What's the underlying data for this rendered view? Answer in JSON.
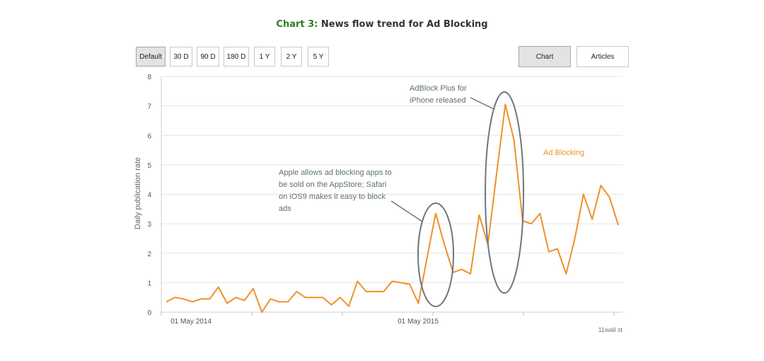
{
  "header": {
    "title_prefix": "Chart 3:",
    "title_text": "News flow trend for Ad Blocking"
  },
  "range_buttons": [
    {
      "label": "Default",
      "active": true
    },
    {
      "label": "30 D",
      "active": false
    },
    {
      "label": "90 D",
      "active": false
    },
    {
      "label": "180 D",
      "active": false
    },
    {
      "label": "1 Y",
      "active": false
    },
    {
      "label": "2 Y",
      "active": false
    },
    {
      "label": "5 Y",
      "active": false
    }
  ],
  "view_toggle": {
    "chart_label": "Chart",
    "articles_label": "Articles",
    "active": "Chart"
  },
  "colors": {
    "series": "#f0902a",
    "annotation": "#5e6f78",
    "title_prefix": "#2e7d1e",
    "grid": "#e4e4e4"
  },
  "chart_data": {
    "type": "line",
    "ylabel": "Daily publication rate",
    "xlabel": "",
    "ylim": [
      0,
      8
    ],
    "yticks": [
      0,
      1,
      2,
      3,
      4,
      5,
      6,
      7,
      8
    ],
    "xtick_labels": [
      "01 May 2014",
      "01 May 2015"
    ],
    "grid": true,
    "series": [
      {
        "name": "Ad Blocking",
        "values": [
          0.35,
          0.5,
          0.45,
          0.35,
          0.45,
          0.45,
          0.85,
          0.3,
          0.5,
          0.4,
          0.8,
          0.0,
          0.45,
          0.35,
          0.35,
          0.7,
          0.5,
          0.5,
          0.5,
          0.25,
          0.5,
          0.2,
          1.05,
          0.7,
          0.7,
          0.7,
          1.05,
          1.0,
          0.95,
          0.3,
          1.85,
          3.35,
          2.3,
          1.35,
          1.45,
          1.3,
          3.3,
          2.3,
          4.7,
          7.05,
          5.85,
          3.1,
          3.0,
          3.35,
          2.05,
          2.15,
          1.3,
          2.5,
          4.0,
          3.15,
          4.3,
          3.9,
          2.95
        ]
      }
    ],
    "annotations": [
      {
        "lines": [
          "Apple allows ad blocking apps to",
          "be sold on the AppStore; Safari",
          "on iOS9 makes it easy to block",
          "ads"
        ]
      },
      {
        "lines": [
          "AdBlock Plus for",
          "iPhone released"
        ]
      }
    ],
    "credit": "11wall st"
  }
}
